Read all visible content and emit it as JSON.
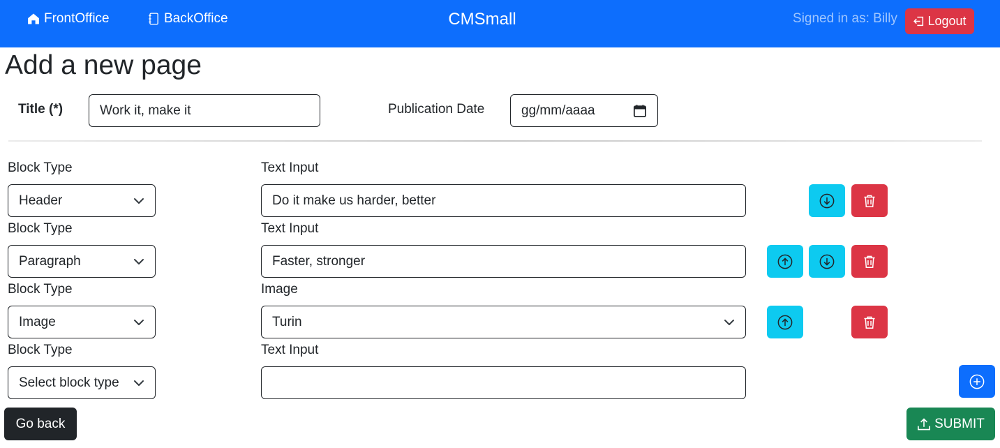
{
  "navbar": {
    "front_label": "FrontOffice",
    "back_label": "BackOffice",
    "brand": "CMSmall",
    "signed_in": "Signed in as: Billy",
    "logout_label": "Logout"
  },
  "page": {
    "title": "Add a new page"
  },
  "form": {
    "title_label": "Title (*)",
    "title_value": "Work it, make it",
    "date_label": "Publication Date",
    "date_value": "gg/mm/aaaa"
  },
  "blocks": [
    {
      "type_label": "Block Type",
      "type_value": "Header",
      "content_label": "Text Input",
      "content_value": "Do it make us harder, better"
    },
    {
      "type_label": "Block Type",
      "type_value": "Paragraph",
      "content_label": "Text Input",
      "content_value": "Faster, stronger"
    },
    {
      "type_label": "Block Type",
      "type_value": "Image",
      "content_label": "Image",
      "content_value": "Turin"
    },
    {
      "type_label": "Block Type",
      "type_value": "Select block type",
      "content_label": "Text Input",
      "content_value": ""
    }
  ],
  "actions": {
    "back_label": "Go back",
    "submit_label": "SUBMIT"
  },
  "colors": {
    "navbar": "#0d6efd",
    "danger": "#dc3545",
    "info": "#0dcaf0",
    "success": "#198754",
    "dark": "#212529"
  },
  "icons": [
    "house-icon",
    "journal-icon",
    "logout-arrow-icon",
    "arrow-down-circle-icon",
    "arrow-up-circle-icon",
    "trash-icon",
    "plus-circle-icon",
    "upload-icon",
    "calendar-icon",
    "chevron-down-icon"
  ]
}
